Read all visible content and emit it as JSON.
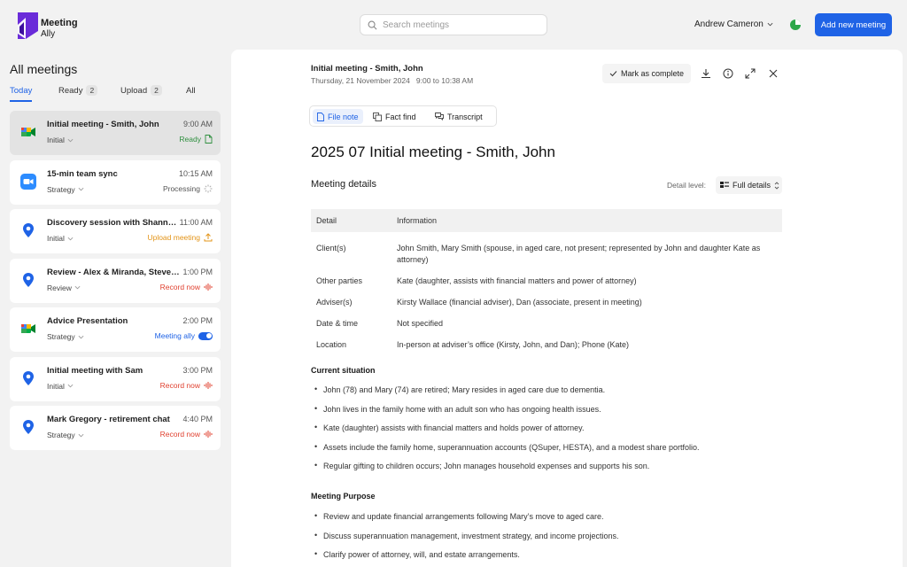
{
  "app": {
    "name": "Meeting",
    "sub": "Ally"
  },
  "search": {
    "placeholder": "Search meetings"
  },
  "user": {
    "name": "Andrew Cameron"
  },
  "add_button": "Add new meeting",
  "sidebar": {
    "title": "All meetings",
    "tabs": [
      {
        "label": "Today",
        "count": ""
      },
      {
        "label": "Ready",
        "count": "2"
      },
      {
        "label": "Upload",
        "count": "2"
      },
      {
        "label": "All",
        "count": ""
      }
    ],
    "meetings": [
      {
        "title": "Initial meeting - Smith, John",
        "time": "9:00 AM",
        "category": "Initial",
        "status": "Ready",
        "icon": "google-meet-icon"
      },
      {
        "title": "15-min team sync",
        "time": "10:15 AM",
        "category": "Strategy",
        "status": "Processing",
        "icon": "zoom-icon"
      },
      {
        "title": "Discovery session with Shannon...",
        "time": "11:00 AM",
        "category": "Initial",
        "status": "Upload meeting",
        "icon": "location-pin-icon"
      },
      {
        "title": "Review - Alex & Miranda, Steven...",
        "time": "1:00 PM",
        "category": "Review",
        "status": "Record now",
        "icon": "location-pin-icon"
      },
      {
        "title": "Advice Presentation",
        "time": "2:00 PM",
        "category": "Strategy",
        "status": "Meeting ally",
        "icon": "google-meet-icon"
      },
      {
        "title": "Initial meeting with Sam",
        "time": "3:00 PM",
        "category": "Initial",
        "status": "Record now",
        "icon": "location-pin-icon"
      },
      {
        "title": "Mark Gregory - retirement chat",
        "time": "4:40 PM",
        "category": "Strategy",
        "status": "Record now",
        "icon": "location-pin-icon"
      }
    ]
  },
  "main": {
    "meeting_title": "Initial meeting - Smith, John",
    "meeting_datetime": "Thursday, 21 November 2024   9:00 to 10:38 AM",
    "mark_complete": "Mark as complete",
    "doc_tabs": [
      "File note",
      "Fact find",
      "Transcript"
    ],
    "doc_title": "2025 07 Initial meeting - Smith, John",
    "details_title": "Meeting details",
    "detail_level_label": "Detail level:",
    "detail_level_value": "Full details",
    "table_header": [
      "Detail",
      "Information"
    ],
    "table_rows": [
      {
        "detail": "Client(s)",
        "info": "John Smith, Mary Smith (spouse, in aged care, not present; represented by John and daughter Kate as attorney)"
      },
      {
        "detail": "Other parties",
        "info": "Kate (daughter, assists with financial matters and power of attorney)"
      },
      {
        "detail": "Adviser(s)",
        "info": "Kirsty Wallace (financial adviser), Dan (associate, present in meeting)"
      },
      {
        "detail": "Date & time",
        "info": "Not specified"
      },
      {
        "detail": "Location",
        "info": "In-person at adviser’s office (Kirsty, John, and Dan); Phone (Kate)"
      }
    ],
    "current_situation_title": "Current situation",
    "current_situation": [
      "John (78) and Mary (74) are retired; Mary resides in aged care due to dementia.",
      "John lives in the family home with an adult son who has ongoing health issues.",
      "Kate (daughter) assists with financial matters and holds power of attorney.",
      "Assets include the family home, superannuation accounts (QSuper, HESTA), and a modest share portfolio.",
      "Regular gifting to children occurs; John manages household expenses and supports his son."
    ],
    "purpose_title": "Meeting Purpose",
    "purpose": [
      "Review and update financial arrangements following Mary’s move to aged care.",
      "Discuss superannuation management, investment strategy, and income projections.",
      "Clarify power of attorney, will, and estate arrangements."
    ]
  },
  "colors": {
    "accent": "#1f63e6",
    "ready": "#2f8f3f",
    "upload": "#e39418",
    "record": "#e0402f",
    "brand": "#6a2bd9"
  }
}
